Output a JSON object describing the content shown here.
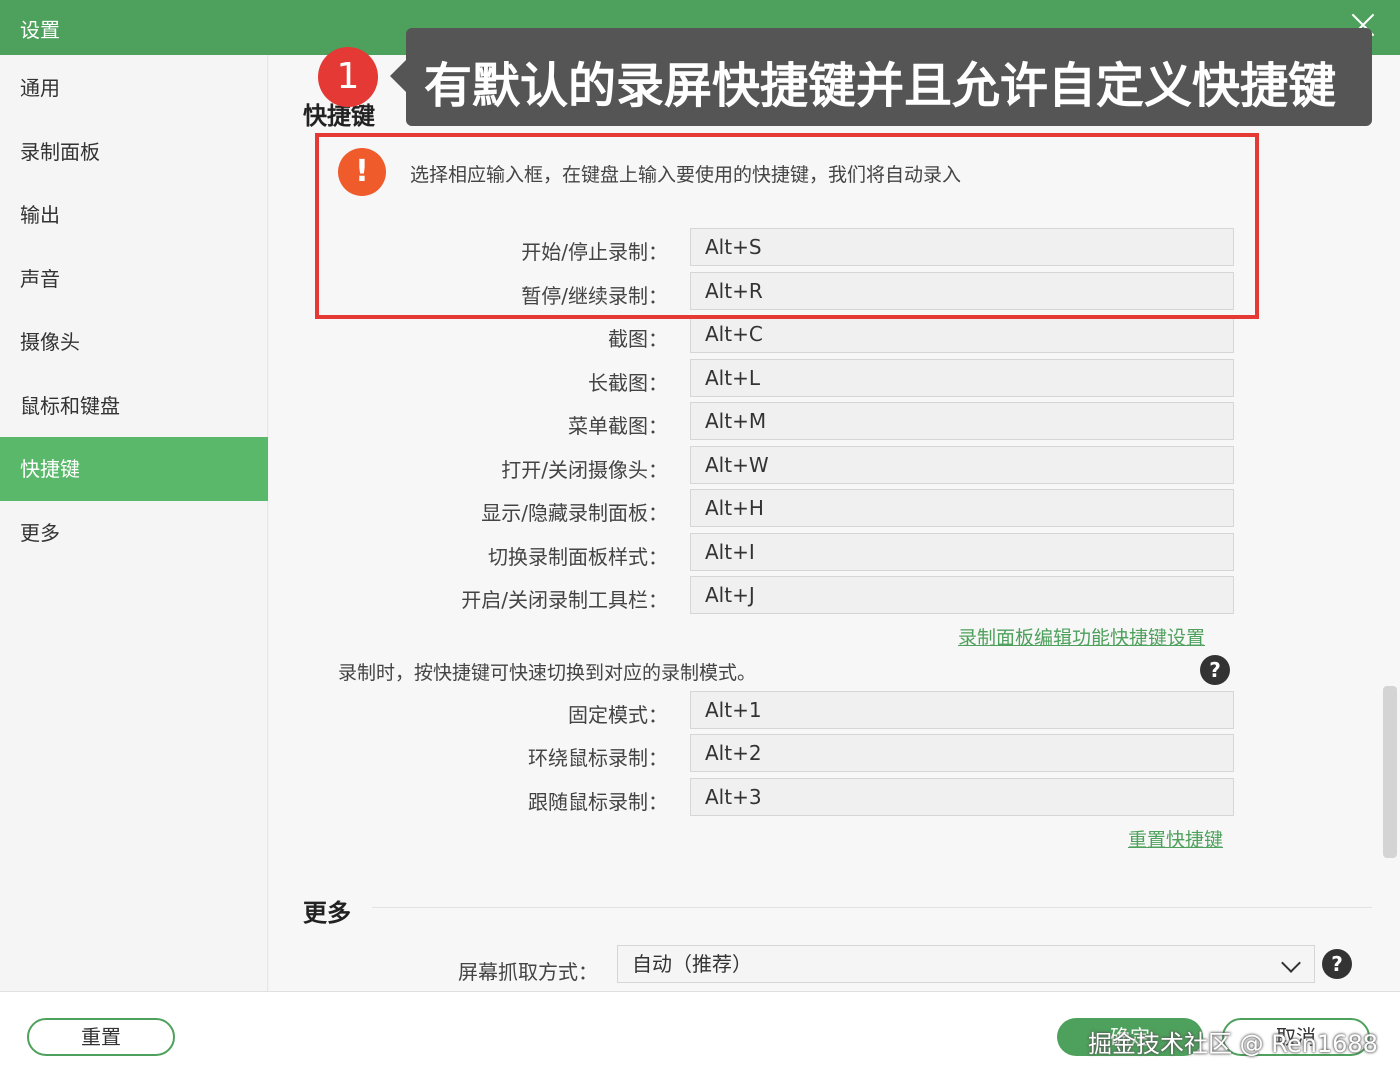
{
  "window": {
    "title": "设置"
  },
  "sidebar": {
    "items": [
      {
        "label": "通用"
      },
      {
        "label": "录制面板"
      },
      {
        "label": "输出"
      },
      {
        "label": "声音"
      },
      {
        "label": "摄像头"
      },
      {
        "label": "鼠标和键盘"
      },
      {
        "label": "快捷键",
        "active": true
      },
      {
        "label": "更多"
      }
    ]
  },
  "annotation": {
    "step_number": "1",
    "callout_text": "有默认的录屏快捷键并且允许自定义快捷键",
    "highlight_color": "#e53935"
  },
  "shortcuts": {
    "section_title": "快捷键",
    "info_text": "选择相应输入框，在键盘上输入要使用的快捷键，我们将自动录入",
    "rows": [
      {
        "label": "开始/停止录制：",
        "value": "Alt+S"
      },
      {
        "label": "暂停/继续录制：",
        "value": "Alt+R"
      },
      {
        "label": "截图：",
        "value": "Alt+C"
      },
      {
        "label": "长截图：",
        "value": "Alt+L"
      },
      {
        "label": "菜单截图：",
        "value": "Alt+M"
      },
      {
        "label": "打开/关闭摄像头：",
        "value": "Alt+W"
      },
      {
        "label": "显示/隐藏录制面板：",
        "value": "Alt+H"
      },
      {
        "label": "切换录制面板样式：",
        "value": "Alt+I"
      },
      {
        "label": "开启/关闭录制工具栏：",
        "value": "Alt+J"
      }
    ],
    "panel_edit_link": "录制面板编辑功能快捷键设置",
    "mode_text": "录制时，按快捷键可快速切换到对应的录制模式。",
    "mode_rows": [
      {
        "label": "固定模式：",
        "value": "Alt+1"
      },
      {
        "label": "环绕鼠标录制：",
        "value": "Alt+2"
      },
      {
        "label": "跟随鼠标录制：",
        "value": "Alt+3"
      }
    ],
    "reset_link": "重置快捷键"
  },
  "more": {
    "section_title": "更多",
    "capture_label": "屏幕抓取方式：",
    "capture_value": "自动（推荐）"
  },
  "footer": {
    "reset_label": "重置",
    "confirm_label": "确定",
    "cancel_label": "取消",
    "watermark": "掘金技术社区 @ Ren1688"
  },
  "colors": {
    "accent": "#4ea15c",
    "active_nav": "#5ab86a",
    "badge": "#e53935",
    "warning": "#ef5b2b"
  }
}
